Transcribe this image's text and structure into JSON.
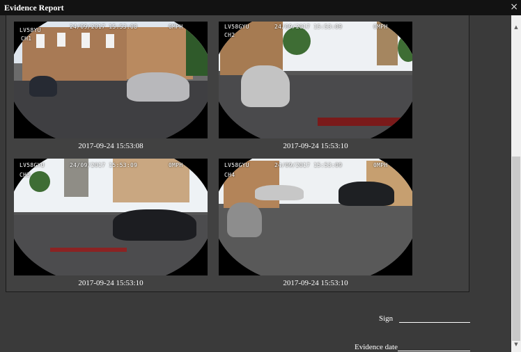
{
  "window": {
    "title": "Evidence Report",
    "close_glyph": "×"
  },
  "images": [
    {
      "plate": "LV58YU",
      "channel": "CH1",
      "stamp": "24/09/2017 15:53:08",
      "speed": "0MPH",
      "caption": "2017-09-24 15:53:08"
    },
    {
      "plate": "LV58GYU",
      "channel": "CH2",
      "stamp": "24/09/2017 15:53:09",
      "speed": "0MPH",
      "caption": "2017-09-24 15:53:10"
    },
    {
      "plate": "LV58GYU",
      "channel": "CH3",
      "stamp": "24/09/2017 15:53:09",
      "speed": "0MPH",
      "caption": "2017-09-24 15:53:10"
    },
    {
      "plate": "LV58GYU",
      "channel": "CH4",
      "stamp": "24/09/2017 15:53:09",
      "speed": "0MPH",
      "caption": "2017-09-24 15:53:10"
    }
  ],
  "form": {
    "sign_label": "Sign",
    "evidence_date_label": "Evidence date"
  },
  "scrollbar": {
    "up_glyph": "▲",
    "down_glyph": "▼"
  }
}
